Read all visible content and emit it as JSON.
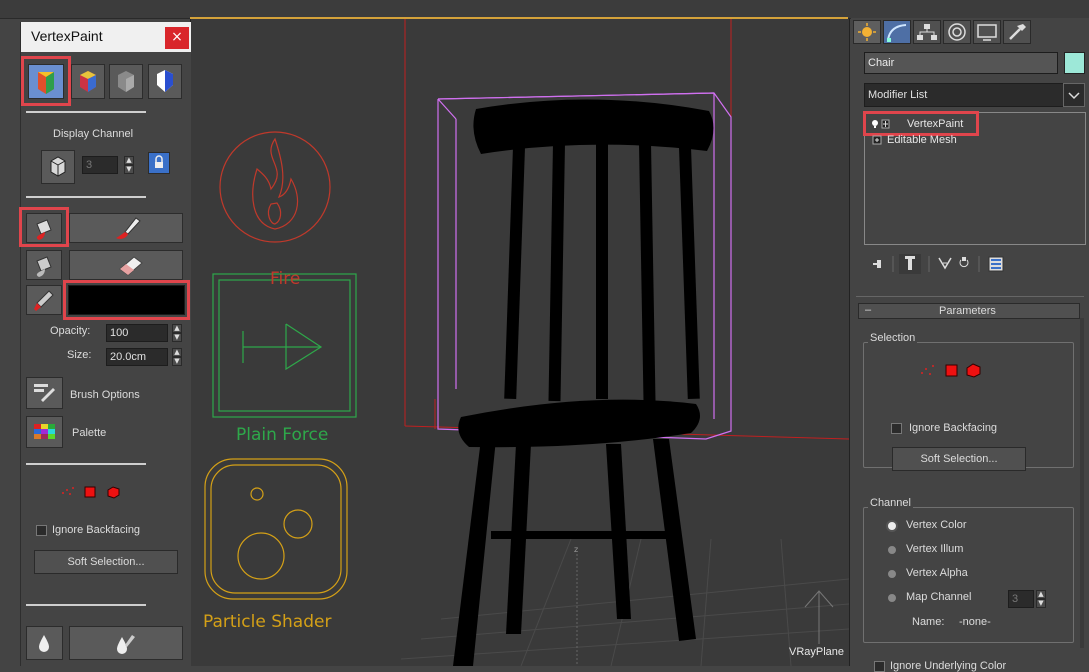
{
  "vertex_paint_panel": {
    "title": "VertexPaint",
    "close_glyph": "×",
    "display_channel_label": "Display Channel",
    "display_channel_value": "3",
    "opacity_label": "Opacity:",
    "opacity_value": "100",
    "size_label": "Size:",
    "size_value": "20.0cm",
    "brush_options_label": "Brush Options",
    "palette_label": "Palette",
    "ignore_backfacing_label": "Ignore Backfacing",
    "soft_selection_label": "Soft Selection...",
    "paint_color": "#000000"
  },
  "viewport": {
    "icons": {
      "fire_label": "Fire",
      "plain_force_label": "Plain Force",
      "particle_shader_label": "Particle Shader"
    },
    "vrayplane_label": "VRayPlane",
    "axis_label": "z"
  },
  "command_panel": {
    "object_name": "Chair",
    "object_color": "#9de8d8",
    "modifier_list_label": "Modifier List",
    "modifier_stack": [
      {
        "label": "VertexPaint"
      },
      {
        "label": "Editable Mesh"
      }
    ],
    "parameters_title": "Parameters",
    "parameters_collapse": "–",
    "selection_group_label": "Selection",
    "ignore_backfacing_label": "Ignore Backfacing",
    "soft_selection_label": "Soft Selection...",
    "channel_group_label": "Channel",
    "channel_options": [
      {
        "label": "Vertex Color",
        "selected": true
      },
      {
        "label": "Vertex Illum",
        "selected": false
      },
      {
        "label": "Vertex Alpha",
        "selected": false
      },
      {
        "label": "Map Channel",
        "selected": false
      }
    ],
    "map_channel_value": "3",
    "name_label": "Name:",
    "name_value": "-none-",
    "ignore_underlying_label": "Ignore Underlying Color"
  },
  "colors": {
    "highlight": "#e0454c",
    "selection_bbox": "#d070f0",
    "fire_icon": "#c0392b",
    "plain_force_icon": "#2ea84a",
    "particle_shader_icon": "#d4a017"
  }
}
